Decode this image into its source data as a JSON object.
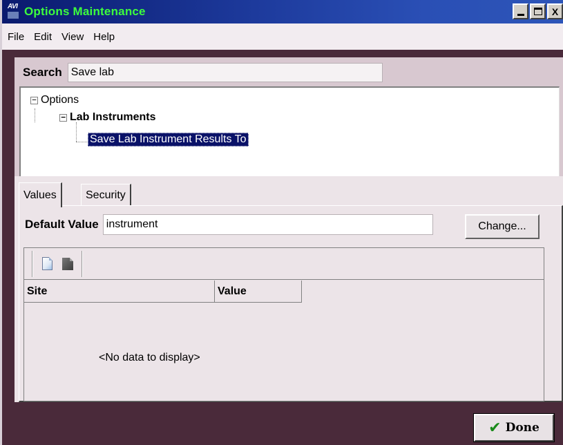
{
  "window": {
    "logo_text": "AVI",
    "title": "Options Maintenance",
    "controls": {
      "close": "X"
    }
  },
  "menu": [
    "File",
    "Edit",
    "View",
    "Help"
  ],
  "search": {
    "label": "Search",
    "value": "Save lab"
  },
  "tree": {
    "root": {
      "label": "Options",
      "expander": "−"
    },
    "group": {
      "label": "Lab Instruments",
      "expander": "−"
    },
    "leaf": {
      "label": "Save Lab Instrument Results To",
      "selected": true
    }
  },
  "tabs": [
    {
      "label": "Values",
      "active": true
    },
    {
      "label": "Security",
      "active": false
    }
  ],
  "values_tab": {
    "default_label": "Default Value",
    "default_value": "instrument",
    "change_label": "Change...",
    "toolbar": {
      "icons": [
        "new-document-icon",
        "dark-document-icon"
      ]
    },
    "columns": [
      "Site",
      "Value"
    ],
    "empty_text": "<No data to display>"
  },
  "footer": {
    "done_label": "Done",
    "done_icon": "✔"
  },
  "colors": {
    "title_text": "#3dff3d",
    "selection": "#0a1268",
    "window_frame": "#4a2a3a",
    "panel": "#d8c8d0"
  }
}
